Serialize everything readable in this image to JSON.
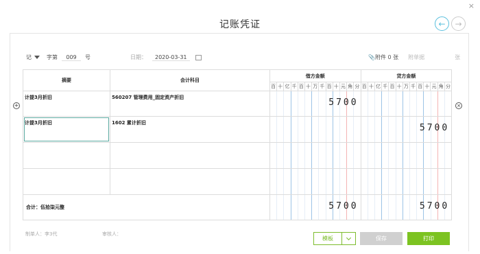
{
  "title": "记账凭证",
  "header": {
    "voucher_word": "记",
    "zi_label": "字第",
    "voucher_no": "009",
    "hao_label": "号",
    "date_label": "日期：",
    "date_value": "2020-03-31",
    "attachment_label": "附件 0 张",
    "doc_no_label": "附单据",
    "zhang_label": "张"
  },
  "columns": {
    "summary": "摘要",
    "account": "会计科目",
    "debit": "借方金额",
    "credit": "贷方金额",
    "digits": [
      "百",
      "十",
      "亿",
      "千",
      "百",
      "十",
      "万",
      "千",
      "百",
      "十",
      "元",
      "角",
      "分"
    ]
  },
  "rows": [
    {
      "summary": "计提3月折旧",
      "account": "560207 管理费用_固定资产折旧",
      "debit": "5700",
      "credit": ""
    },
    {
      "summary": "计提3月折旧",
      "account": "1602 累计折旧",
      "debit": "",
      "credit": "5700"
    },
    {
      "summary": "",
      "account": "",
      "debit": "",
      "credit": ""
    },
    {
      "summary": "",
      "account": "",
      "debit": "",
      "credit": ""
    }
  ],
  "total": {
    "label": "合计：伍拾柒元整",
    "debit": "5700",
    "credit": "5700"
  },
  "footer": {
    "maker": "制单人：李3代",
    "reviewer": "审核人："
  },
  "buttons": {
    "template": "模板",
    "save": "保存",
    "print": "打印"
  },
  "icons": {
    "prev": "←",
    "next": "→",
    "close": "×",
    "add_row": "+",
    "remove_row": "×",
    "attachment": "paperclip-icon",
    "calendar": "calendar-icon"
  }
}
